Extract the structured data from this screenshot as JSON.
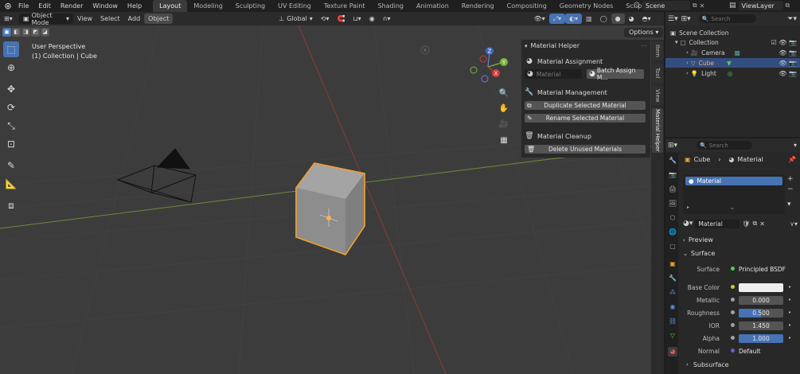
{
  "topbar": {
    "menus": [
      "File",
      "Edit",
      "Render",
      "Window",
      "Help"
    ],
    "workspaces": [
      "Layout",
      "Modeling",
      "Sculpting",
      "UV Editing",
      "Texture Paint",
      "Shading",
      "Animation",
      "Rendering",
      "Compositing",
      "Geometry Nodes",
      "Scripting"
    ],
    "active_workspace": "Layout",
    "add_tab": "+",
    "scene": "Scene",
    "view_layer": "ViewLayer"
  },
  "viewport_header": {
    "mode": "Object Mode",
    "menus": [
      "View",
      "Select",
      "Add",
      "Object"
    ],
    "transform": "Global",
    "options": "Options"
  },
  "viewport": {
    "perspective": "User Perspective",
    "collection_info": "(1) Collection | Cube",
    "gizmo_axes": [
      "Z",
      "Y",
      "X"
    ]
  },
  "npanel": {
    "title": "Material Helper",
    "assignment_title": "Material Assignment",
    "material_placeholder": "Material",
    "batch_assign": "Batch Assign M...",
    "management_title": "Material Management",
    "duplicate_btn": "Duplicate Selected Material",
    "rename_btn": "Rename Selected Material",
    "cleanup_title": "Material Cleanup",
    "delete_btn": "Delete Unused Materials"
  },
  "side_tabs": [
    "Item",
    "Tool",
    "View",
    "Material Helper"
  ],
  "outliner": {
    "search_placeholder": "Search",
    "scene_collection": "Scene Collection",
    "collection": "Collection",
    "items": [
      "Camera",
      "Cube",
      "Light"
    ],
    "selected": "Cube"
  },
  "properties": {
    "search_placeholder": "Search",
    "breadcrumb_object": "Cube",
    "breadcrumb_material": "Material",
    "slot_name": "Material",
    "material_name": "Material",
    "preview": "Preview",
    "surface_section": "Surface",
    "surface_label": "Surface",
    "surface_value": "Principled BSDF",
    "rows": [
      {
        "label": "Base Color",
        "value": ""
      },
      {
        "label": "Metallic",
        "value": "0.000"
      },
      {
        "label": "Roughness",
        "value": "0.500"
      },
      {
        "label": "IOR",
        "value": "1.450"
      },
      {
        "label": "Alpha",
        "value": "1.000"
      }
    ],
    "normal_label": "Normal",
    "normal_value": "Default",
    "subsurface": "Subsurface"
  },
  "colors": {
    "accent": "#4772b3",
    "selection": "#334d80",
    "object_outline": "#f0a030"
  }
}
